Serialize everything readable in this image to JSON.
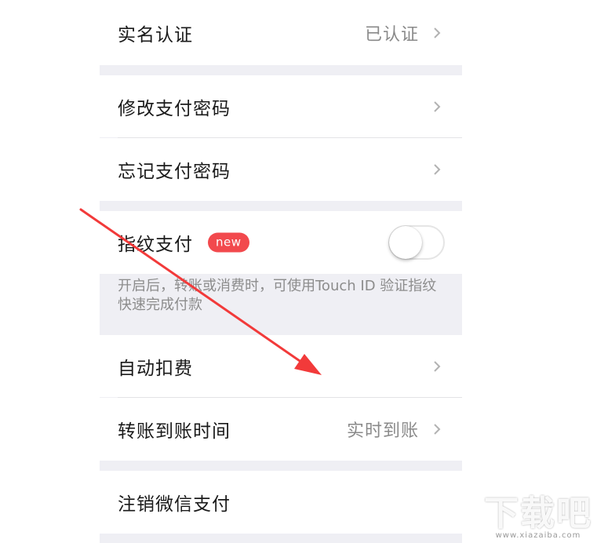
{
  "rows": {
    "realname": {
      "label": "实名认证",
      "value": "已认证"
    },
    "change_pwd": {
      "label": "修改支付密码"
    },
    "forgot_pwd": {
      "label": "忘记支付密码"
    },
    "fingerprint": {
      "label": "指纹支付",
      "badge": "new",
      "toggle_on": false
    },
    "auto_deduct": {
      "label": "自动扣费"
    },
    "transfer_time": {
      "label": "转账到账时间",
      "value": "实时到账"
    },
    "cancel_wechat_pay": {
      "label": "注销微信支付"
    }
  },
  "fingerprint_note": "开启后，转账或消费时，可使用Touch ID 验证指纹快速完成付款",
  "icons": {
    "chevron": "chevron-right-icon",
    "arrow": "annotation-arrow-icon"
  },
  "colors": {
    "badge": "#f2494d",
    "arrow": "#f23a3a",
    "group_bg": "#efeff4"
  },
  "watermark": {
    "logo_text": "下载吧",
    "url_text": "www.xiazaiba.com"
  }
}
